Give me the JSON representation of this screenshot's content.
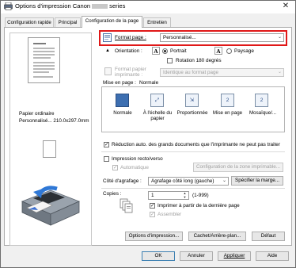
{
  "window": {
    "title_prefix": "Options d'impression Canon",
    "title_suffix": "series",
    "close_glyph": "✕"
  },
  "tabs": [
    {
      "label": "Configuration rapide",
      "active": false
    },
    {
      "label": "Principal",
      "active": false
    },
    {
      "label": "Configuration de la page",
      "active": true
    },
    {
      "label": "Entretien",
      "active": false
    }
  ],
  "preview": {
    "media_type": "Papier ordinaire",
    "media_size": "Personnalisé... 210.0x297.0mm"
  },
  "page_setup": {
    "page_size_label": "Format page :",
    "page_size_value": "Personnalisé...",
    "orientation_label": "Orientation :",
    "portrait_label": "Portrait",
    "landscape_label": "Paysage",
    "orientation_selected": "Portrait",
    "rotate180_label": "Rotation 180 degrés",
    "rotate180_checked": false,
    "printer_paper_label_1": "Format papier",
    "printer_paper_label_2": "imprimante :",
    "printer_paper_value": "Identique au format page",
    "layout_label": "Mise en page :",
    "layout_value": "Normale",
    "layouts": [
      {
        "label_1": "Normale",
        "label_2": "",
        "icon": "normal-layout-icon",
        "selected": true
      },
      {
        "label_1": "À l'échelle du",
        "label_2": "papier",
        "icon": "fit-to-page-icon",
        "selected": false
      },
      {
        "label_1": "Proportionnée",
        "label_2": "",
        "icon": "scaled-icon",
        "selected": false
      },
      {
        "label_1": "Mise en page",
        "label_2": "",
        "icon": "page-layout-icon",
        "selected": false
      },
      {
        "label_1": "Mosaïque/...",
        "label_2": "",
        "icon": "tiling-icon",
        "selected": false
      }
    ],
    "auto_reduce_label": "Réduction auto. des grands documents que l'imprimante ne peut pas traiter",
    "auto_reduce_checked": true,
    "duplex_label": "Impression recto/verso",
    "duplex_checked": false,
    "automatic_label": "Automatique",
    "automatic_checked": true,
    "margin_area_button": "Configuration de la zone imprimable...",
    "stapling_label": "Côté d'agrafage :",
    "stapling_value": "Agrafage côté long (gauche)",
    "margin_button": "Spécifier la marge...",
    "copies_label": "Copies :",
    "copies_value": "1",
    "copies_range": "(1-999)",
    "last_page_first_label": "Imprimer à partir de la dernière page",
    "last_page_first_checked": true,
    "collate_label": "Assembler",
    "collate_checked": true,
    "print_options_button": "Options d'impression...",
    "stamp_button": "Cachet/Arrière-plan...",
    "defaults_button": "Défaut"
  },
  "footer": {
    "ok": "OK",
    "cancel": "Annuler",
    "apply": "Appliquer",
    "help": "Aide"
  },
  "colors": {
    "highlight_frame": "#e01818",
    "selected_layout": "#3d6fb1"
  }
}
